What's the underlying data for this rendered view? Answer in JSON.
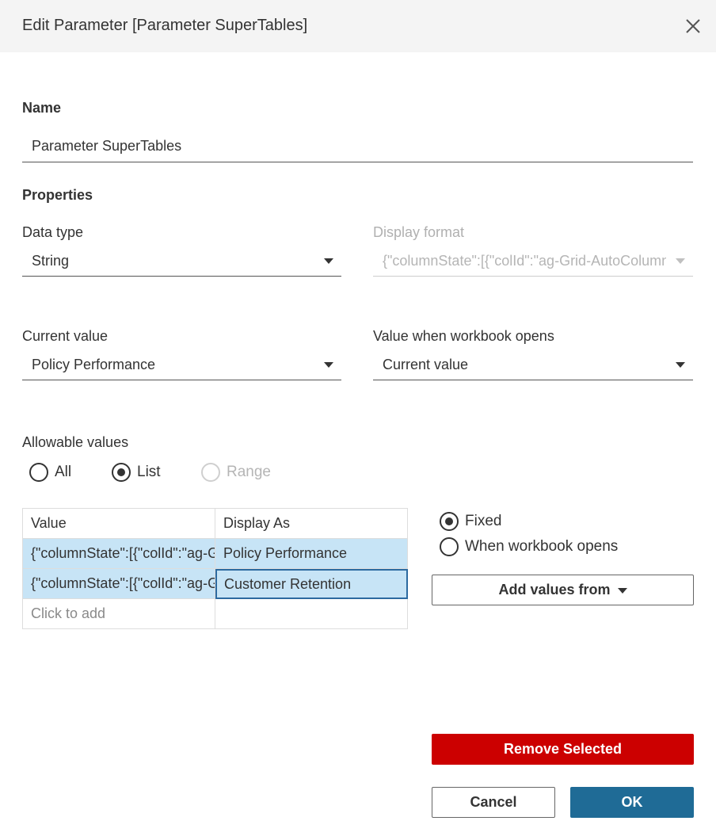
{
  "dialog": {
    "title": "Edit Parameter [Parameter SuperTables]",
    "close_icon": "close-icon"
  },
  "name_section": {
    "label": "Name",
    "value": "Parameter SuperTables"
  },
  "properties": {
    "heading": "Properties",
    "data_type": {
      "label": "Data type",
      "value": "String"
    },
    "display_format": {
      "label": "Display format",
      "value": "{\"columnState\":[{\"colId\":\"ag-Grid-AutoColumn\"",
      "disabled": true
    },
    "current_value": {
      "label": "Current value",
      "value": "Policy Performance"
    },
    "value_when_opens": {
      "label": "Value when workbook opens",
      "value": "Current value"
    }
  },
  "allowable_values": {
    "label": "Allowable values",
    "options": [
      {
        "label": "All",
        "selected": false,
        "disabled": false
      },
      {
        "label": "List",
        "selected": true,
        "disabled": false
      },
      {
        "label": "Range",
        "selected": false,
        "disabled": true
      }
    ]
  },
  "list_table": {
    "headers": [
      "Value",
      "Display As"
    ],
    "rows": [
      {
        "value": "{\"columnState\":[{\"colId\":\"ag-Grid-AutoColumn\"",
        "display": "Policy Performance",
        "selected": true
      },
      {
        "value": "{\"columnState\":[{\"colId\":\"ag-Grid-AutoColumn\"",
        "display": "Customer Retention",
        "selected": true
      }
    ],
    "add_placeholder": "Click to add"
  },
  "list_source": {
    "options": [
      {
        "label": "Fixed",
        "selected": true
      },
      {
        "label": "When workbook opens",
        "selected": false
      }
    ],
    "add_values_from": "Add values from"
  },
  "buttons": {
    "remove_selected": "Remove Selected",
    "cancel": "Cancel",
    "ok": "OK"
  },
  "colors": {
    "danger": "#cc0000",
    "primary": "#1f6b96",
    "selection": "#c7e4f6"
  }
}
